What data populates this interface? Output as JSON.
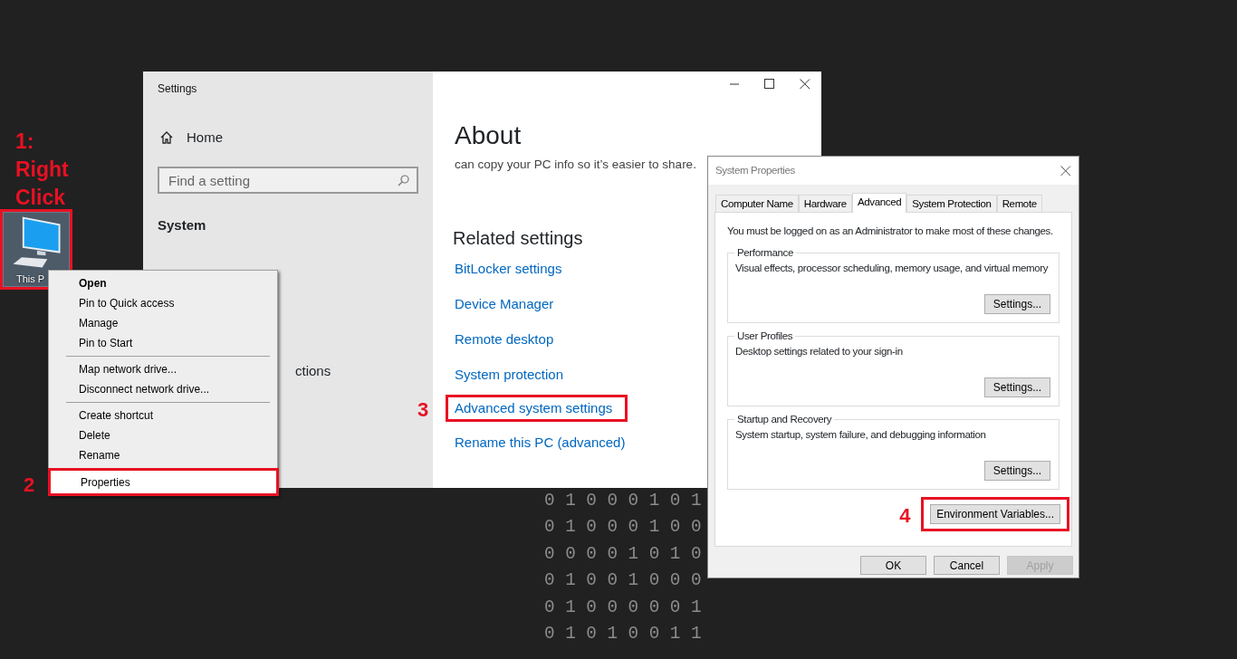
{
  "desktop_icon": {
    "label": "This P",
    "annotated": true,
    "annotation": "1: Right Click"
  },
  "settings_window": {
    "title": "Settings",
    "sidebar": {
      "home": "Home",
      "search": {
        "placeholder": "Find a setting"
      },
      "section": "System",
      "partial_item": "ctions"
    },
    "content": {
      "heading": "About",
      "intro": "can copy your PC info so it’s easier to share.",
      "related_heading": "Related settings",
      "links": [
        {
          "label": "BitLocker settings",
          "annotated": false
        },
        {
          "label": "Device Manager",
          "annotated": false
        },
        {
          "label": "Remote desktop",
          "annotated": false
        },
        {
          "label": "System protection",
          "annotated": false
        },
        {
          "label": "Advanced system settings",
          "annotated": true,
          "annotation": "3"
        },
        {
          "label": "Rename this PC (advanced)",
          "annotated": false
        }
      ]
    }
  },
  "context_menu": {
    "items": [
      {
        "label": "Open",
        "default": true,
        "separator_before": false,
        "selected": false,
        "annotated": false
      },
      {
        "label": "Pin to Quick access",
        "default": false,
        "separator_before": false,
        "selected": false,
        "annotated": false
      },
      {
        "label": "Manage",
        "default": false,
        "separator_before": false,
        "selected": false,
        "annotated": false
      },
      {
        "label": "Pin to Start",
        "default": false,
        "separator_before": false,
        "selected": false,
        "annotated": false
      },
      {
        "label": "Map network drive...",
        "default": false,
        "separator_before": true,
        "selected": false,
        "annotated": false
      },
      {
        "label": "Disconnect network drive...",
        "default": false,
        "separator_before": false,
        "selected": false,
        "annotated": false
      },
      {
        "label": "Create shortcut",
        "default": false,
        "separator_before": true,
        "selected": false,
        "annotated": false
      },
      {
        "label": "Delete",
        "default": false,
        "separator_before": false,
        "selected": false,
        "annotated": false
      },
      {
        "label": "Rename",
        "default": false,
        "separator_before": false,
        "selected": false,
        "annotated": false
      },
      {
        "label": "Properties",
        "default": false,
        "separator_before": false,
        "selected": true,
        "annotated": true,
        "annotation": "2"
      }
    ]
  },
  "system_properties": {
    "title": "System Properties",
    "tabs": [
      {
        "label": "Computer Name",
        "selected": false
      },
      {
        "label": "Hardware",
        "selected": false
      },
      {
        "label": "Advanced",
        "selected": true
      },
      {
        "label": "System Protection",
        "selected": false
      },
      {
        "label": "Remote",
        "selected": false
      }
    ],
    "notice": "You must be logged on as an Administrator to make most of these changes.",
    "groups": [
      {
        "title": "Performance",
        "description": "Visual effects, processor scheduling, memory usage, and virtual memory",
        "button": "Settings..."
      },
      {
        "title": "User Profiles",
        "description": "Desktop settings related to your sign-in",
        "button": "Settings..."
      },
      {
        "title": "Startup and Recovery",
        "description": "System startup, system failure, and debugging information",
        "button": "Settings..."
      }
    ],
    "env_button": {
      "label": "Environment Variables...",
      "annotated": true,
      "annotation": "4"
    },
    "buttons": [
      {
        "label": "OK",
        "disabled": false
      },
      {
        "label": "Cancel",
        "disabled": false
      },
      {
        "label": "Apply",
        "disabled": true
      }
    ]
  },
  "binary_rows": [
    "0 1 0 0 0 1 0 1",
    "0 1 0 0 0 1 0 0",
    "0 0 0 0 1 0 1 0",
    "0 1 0 0 1 0 0 0",
    "0 1 0 0 0 0 0 1",
    "0 1 0 1 0 0 1 1"
  ]
}
